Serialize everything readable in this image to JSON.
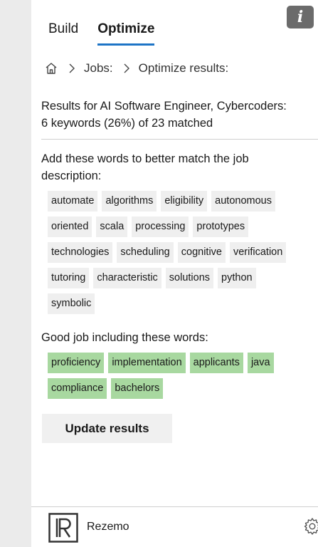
{
  "tabs": [
    {
      "label": "Build",
      "active": false
    },
    {
      "label": "Optimize",
      "active": true
    }
  ],
  "breadcrumb": {
    "items": [
      "Jobs:",
      "Optimize results:"
    ]
  },
  "results": {
    "line1": "Results for AI Software Engineer, Cybercoders:",
    "line2": "6 keywords (26%) of 23 matched"
  },
  "add_words": {
    "title": "Add these words to better match the job description:",
    "keywords": [
      "automate",
      "algorithms",
      "eligibility",
      "autonomous",
      "oriented",
      "scala",
      "processing",
      "prototypes",
      "technologies",
      "scheduling",
      "cognitive",
      "verification",
      "tutoring",
      "characteristic",
      "solutions",
      "python",
      "symbolic"
    ]
  },
  "good_words": {
    "title": "Good job including these words:",
    "keywords": [
      "proficiency",
      "implementation",
      "applicants",
      "java",
      "compliance",
      "bachelors"
    ]
  },
  "update_button": {
    "label": "Update results"
  },
  "footer": {
    "brand": "Rezemo"
  },
  "info_button": {
    "label": "i"
  },
  "colors": {
    "accent": "#1d74c6",
    "matched_chip": "#a8d8a0",
    "chip": "#efefef"
  }
}
